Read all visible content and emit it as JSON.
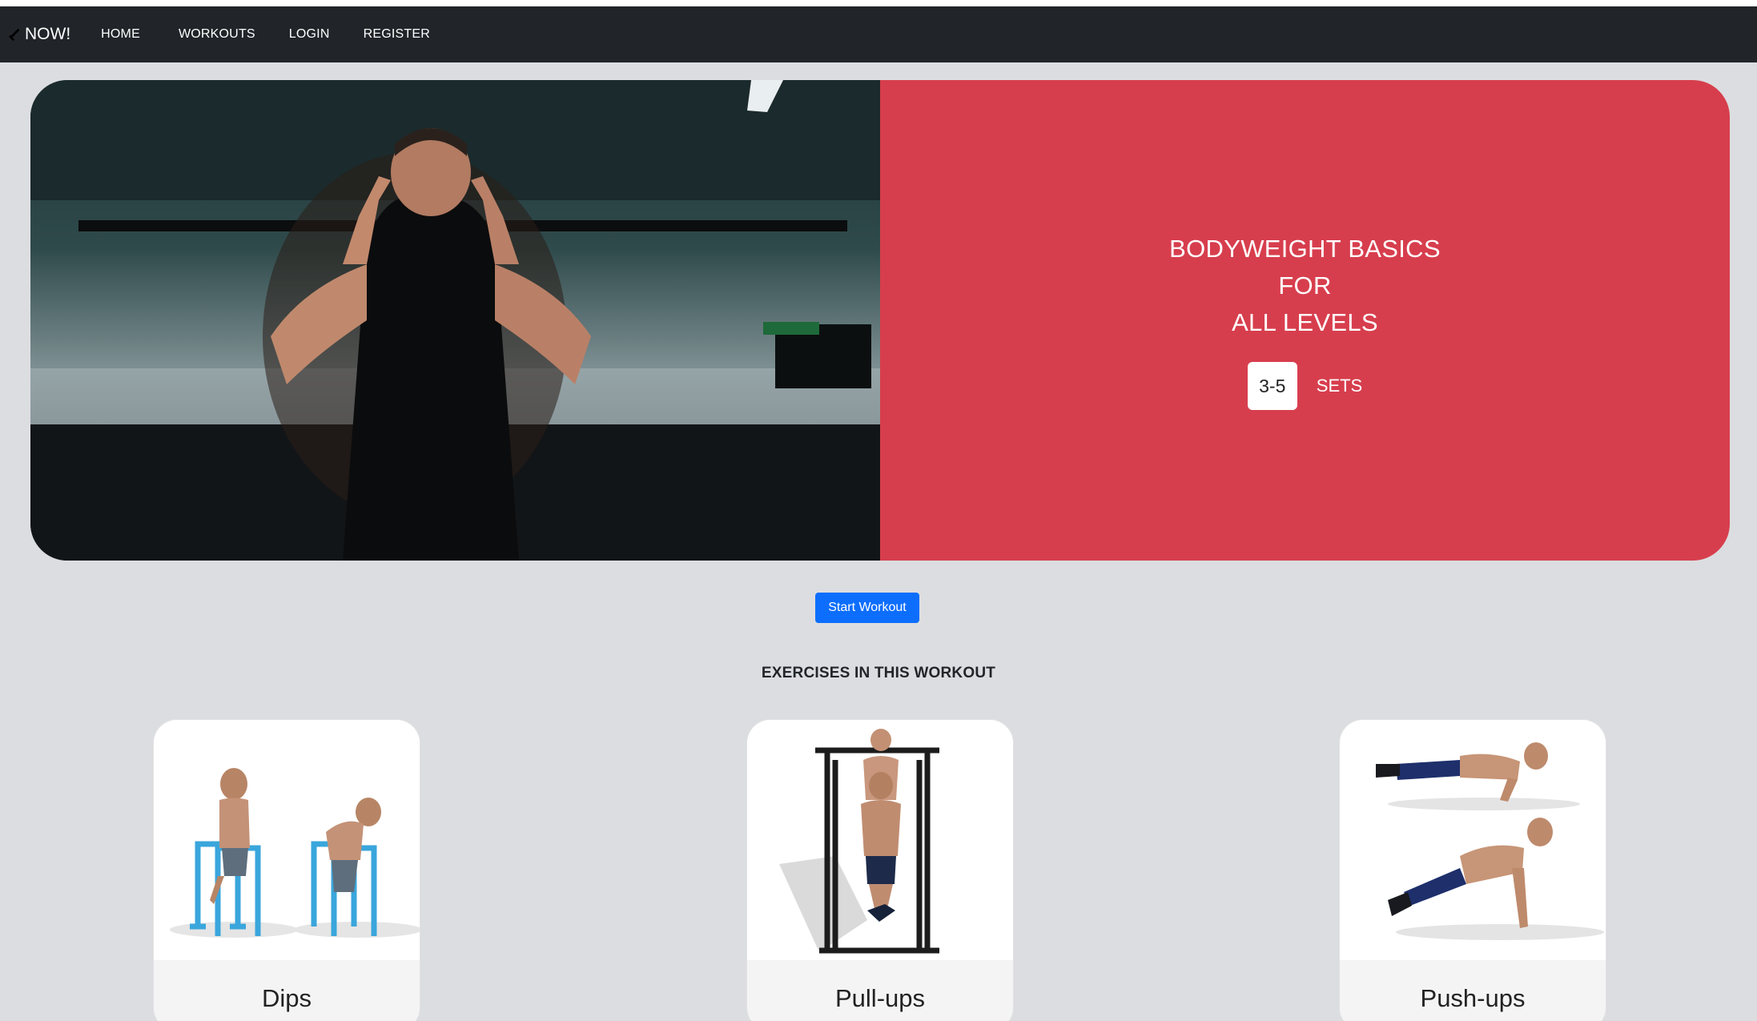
{
  "navbar": {
    "brand": "NOW!",
    "links": [
      "HOME",
      "WORKOUTS",
      "LOGIN",
      "REGISTER"
    ]
  },
  "hero": {
    "title_lines": [
      "BODYWEIGHT BASICS",
      "FOR",
      "ALL LEVELS"
    ],
    "sets_value": "3-5",
    "sets_label": "SETS"
  },
  "start_button": "Start Workout",
  "section_title": "EXERCISES IN THIS WORKOUT",
  "exercises": [
    {
      "name": "Dips"
    },
    {
      "name": "Pull-ups"
    },
    {
      "name": "Push-ups"
    }
  ],
  "colors": {
    "navbar": "#212529",
    "page_bg": "#dcdde0",
    "hero_panel": "#d73e4d",
    "primary_button": "#0d6efd"
  }
}
